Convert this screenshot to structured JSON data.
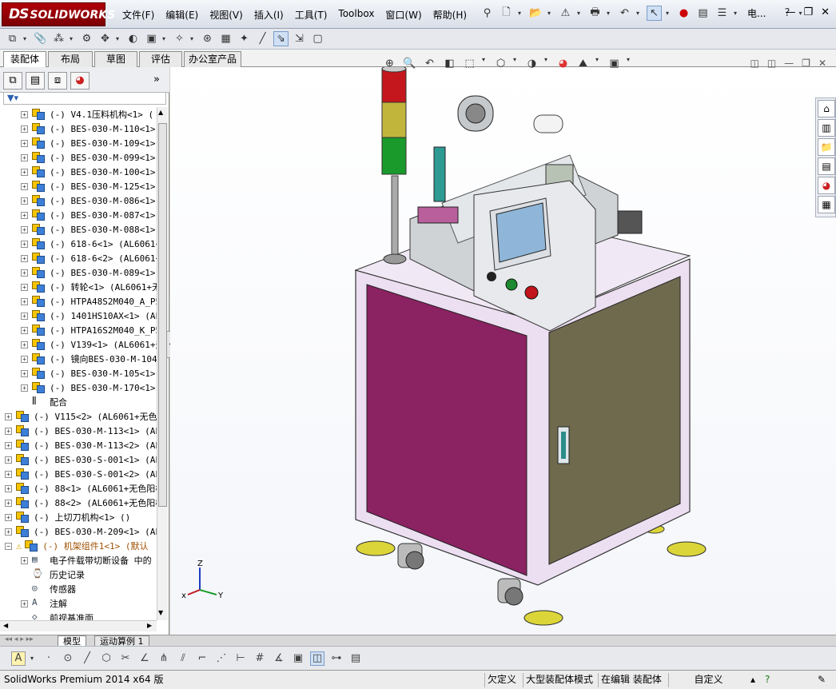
{
  "app": {
    "logo_prefix": "DS",
    "logo_text": "SOLIDWORKS"
  },
  "menu": [
    "文件(F)",
    "编辑(E)",
    "视图(V)",
    "插入(I)",
    "工具(T)",
    "Toolbox",
    "窗口(W)",
    "帮助(H)"
  ],
  "titlebar": {
    "doc_short": "电...",
    "help": "?"
  },
  "command_tabs": [
    "装配体",
    "布局",
    "草图",
    "评估",
    "办公室产品"
  ],
  "tree_rows": [
    {
      "exp": "+",
      "label": "(-) V4.1压料机构<1> (",
      "kind": "assy",
      "warn": false
    },
    {
      "exp": "+",
      "label": "(-) BES-030-M-110<1> (",
      "kind": "part",
      "warn": false
    },
    {
      "exp": "+",
      "label": "(-) BES-030-M-109<1> (",
      "kind": "part",
      "warn": false
    },
    {
      "exp": "+",
      "label": "(-) BES-030-M-099<1> (",
      "kind": "part",
      "warn": false
    },
    {
      "exp": "+",
      "label": "(-) BES-030-M-100<1> (",
      "kind": "part",
      "warn": false
    },
    {
      "exp": "+",
      "label": "(-) BES-030-M-125<1> (",
      "kind": "part",
      "warn": false
    },
    {
      "exp": "+",
      "label": "(-) BES-030-M-086<1> (",
      "kind": "part",
      "warn": false
    },
    {
      "exp": "+",
      "label": "(-) BES-030-M-087<1> (",
      "kind": "part",
      "warn": false
    },
    {
      "exp": "+",
      "label": "(-) BES-030-M-088<1> (",
      "kind": "part",
      "warn": false
    },
    {
      "exp": "+",
      "label": "(-) 618-6<1> (AL6061+无",
      "kind": "part",
      "warn": false
    },
    {
      "exp": "+",
      "label": "(-) 618-6<2> (AL6061+无",
      "kind": "part",
      "warn": false
    },
    {
      "exp": "+",
      "label": "(-) BES-030-M-089<1> (",
      "kind": "part",
      "warn": false
    },
    {
      "exp": "+",
      "label": "(-) 转轮<1> (AL6061+无",
      "kind": "part",
      "warn": false
    },
    {
      "exp": "+",
      "label": "(-) HTPA48S2M040_A_P5_",
      "kind": "part",
      "warn": false
    },
    {
      "exp": "+",
      "label": "(-) 1401HS10AX<1> (AL6",
      "kind": "part",
      "warn": false
    },
    {
      "exp": "+",
      "label": "(-) HTPA16S2M040_K_P5_",
      "kind": "part",
      "warn": false
    },
    {
      "exp": "+",
      "label": "(-) V139<1> (AL6061+无",
      "kind": "part",
      "warn": false
    },
    {
      "exp": "+",
      "label": "(-) 镜向BES-030-M-104<",
      "kind": "part",
      "warn": false
    },
    {
      "exp": "+",
      "label": "(-) BES-030-M-105<1> (",
      "kind": "part",
      "warn": false
    },
    {
      "exp": "+",
      "label": "(-) BES-030-M-170<1> (",
      "kind": "part",
      "warn": false
    },
    {
      "exp": "",
      "label": "配合",
      "kind": "mate",
      "warn": false
    },
    {
      "exp": "+",
      "label": "(-) V115<2> (AL6061+无色阳",
      "kind": "part",
      "warn": false
    },
    {
      "exp": "+",
      "label": "(-) BES-030-M-113<1> (AL6",
      "kind": "part",
      "warn": false
    },
    {
      "exp": "+",
      "label": "(-) BES-030-M-113<2> (AL6",
      "kind": "part",
      "warn": false
    },
    {
      "exp": "+",
      "label": "(-) BES-030-S-001<1> (AL6",
      "kind": "part",
      "warn": false
    },
    {
      "exp": "+",
      "label": "(-) BES-030-S-001<2> (AL6",
      "kind": "part",
      "warn": false
    },
    {
      "exp": "+",
      "label": "(-) 88<1> (AL6061+无色阳极",
      "kind": "part",
      "warn": false
    },
    {
      "exp": "+",
      "label": "(-) 88<2> (AL6061+无色阳极",
      "kind": "part",
      "warn": false
    },
    {
      "exp": "+",
      "label": "(-) 上切刀机构<1> ()",
      "kind": "assy",
      "warn": false
    },
    {
      "exp": "+",
      "label": "(-) BES-030-M-209<1> (AL6",
      "kind": "part",
      "warn": false
    },
    {
      "exp": "-",
      "label": "(-) 机架组件1<1> (默认",
      "kind": "assy",
      "warn": true
    },
    {
      "exp": "+",
      "label": "电子件载带切断设备 中的",
      "kind": "doc",
      "warn": false
    },
    {
      "exp": "",
      "label": "历史记录",
      "kind": "history",
      "warn": false
    },
    {
      "exp": "",
      "label": "传感器",
      "kind": "sensor",
      "warn": false
    },
    {
      "exp": "+",
      "label": "注解",
      "kind": "annot",
      "warn": false
    },
    {
      "exp": "",
      "label": "前视基准面",
      "kind": "plane",
      "warn": false
    }
  ],
  "bottom_tabs": [
    "模型",
    "运动算例 1"
  ],
  "status": {
    "app": "SolidWorks Premium 2014 x64 版",
    "s1": "欠定义",
    "s2": "大型装配体模式",
    "s3": "在编辑 装配体",
    "s4": "自定义"
  },
  "triad": {
    "x": "x",
    "y": "Y",
    "z": "Z"
  },
  "colors": {
    "accent": "#b00008",
    "cabinet_front": "#8b2262",
    "cabinet_side": "#6f6a4e",
    "frame": "#eadaf0"
  }
}
